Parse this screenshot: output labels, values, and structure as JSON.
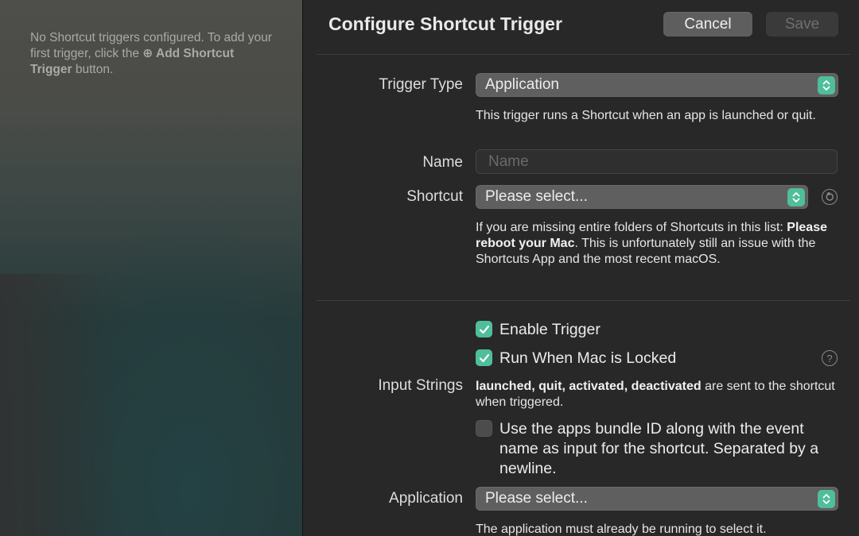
{
  "sidebar": {
    "empty_text_1": "No Shortcut triggers configured. To add your first trigger, click the ",
    "empty_icon": "⊕",
    "empty_bold": " Add Shortcut Trigger",
    "empty_text_2": " button."
  },
  "header": {
    "title": "Configure Shortcut Trigger",
    "cancel_label": "Cancel",
    "save_label": "Save"
  },
  "form": {
    "trigger_type": {
      "label": "Trigger Type",
      "value": "Application",
      "help": "This trigger runs a Shortcut when an app is launched or quit."
    },
    "name": {
      "label": "Name",
      "value": "",
      "placeholder": "Name"
    },
    "shortcut": {
      "label": "Shortcut",
      "value": "Please select...",
      "help_1": "If you are missing entire folders of Shortcuts in this list: ",
      "help_bold": "Please reboot your Mac",
      "help_2": ". This is unfortunately still an issue with the Shortcuts App and the most recent macOS."
    },
    "enable_trigger": {
      "label": "Enable Trigger",
      "checked": true
    },
    "run_when_locked": {
      "label": "Run When Mac is Locked",
      "checked": true
    },
    "input_strings": {
      "label": "Input Strings",
      "help_bold": "launched, quit, activated, deactivated",
      "help_rest": " are sent to the shortcut when triggered."
    },
    "bundle_id": {
      "label": "Use the apps bundle ID along with the event name as input for the shortcut. Separated by a newline.",
      "checked": false
    },
    "application": {
      "label": "Application",
      "value": "Please select...",
      "help": "The application must already be running to select it."
    }
  },
  "icons": {
    "stepper": "up-down-chevrons",
    "refresh": "↻",
    "help": "?",
    "checkmark": "✓"
  },
  "colors": {
    "accent": "#4fbe9a",
    "window_bg": "#282828",
    "popup_bg": "#5f5f5f"
  }
}
